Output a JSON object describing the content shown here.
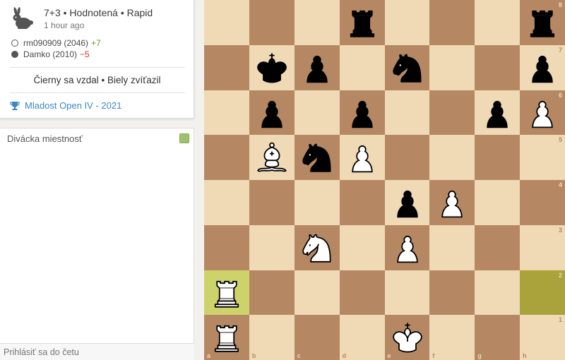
{
  "game": {
    "type": "7+3 • Hodnotená • Rapid",
    "time_ago": "1 hour ago",
    "speed_icon": "rabbit-icon"
  },
  "players": {
    "white": {
      "name": "rm090909 (2046)",
      "diff": "+7"
    },
    "black": {
      "name": "Damko (2010)",
      "diff": "−5"
    }
  },
  "result": "Čierny sa vzdal • Biely zvíťazil",
  "tournament": {
    "icon": "trophy-icon",
    "name": "Mladost Open IV - 2021"
  },
  "chat": {
    "title": "Divácka miestnosť",
    "placeholder": "Prihlásiť sa do četu"
  },
  "board": {
    "files": [
      "a",
      "b",
      "c",
      "d",
      "e",
      "f",
      "g",
      "h"
    ],
    "ranks": [
      "8",
      "7",
      "6",
      "5",
      "4",
      "3",
      "2",
      "1"
    ],
    "colors": {
      "light": "#f0d9b5",
      "dark": "#b58863",
      "highlight_light": "#cdd26a",
      "highlight_dark": "#aaa23a"
    },
    "highlights": [
      "a2",
      "h2"
    ],
    "pieces": [
      {
        "square": "d8",
        "piece": "black-rook"
      },
      {
        "square": "h8",
        "piece": "black-rook"
      },
      {
        "square": "b7",
        "piece": "black-king"
      },
      {
        "square": "c7",
        "piece": "black-pawn"
      },
      {
        "square": "e7",
        "piece": "black-knight"
      },
      {
        "square": "h7",
        "piece": "black-pawn"
      },
      {
        "square": "b6",
        "piece": "black-pawn"
      },
      {
        "square": "d6",
        "piece": "black-pawn"
      },
      {
        "square": "g6",
        "piece": "black-pawn"
      },
      {
        "square": "h6",
        "piece": "white-pawn"
      },
      {
        "square": "b5",
        "piece": "white-bishop"
      },
      {
        "square": "c5",
        "piece": "black-knight"
      },
      {
        "square": "d5",
        "piece": "white-pawn"
      },
      {
        "square": "e4",
        "piece": "black-pawn"
      },
      {
        "square": "f4",
        "piece": "white-pawn"
      },
      {
        "square": "c3",
        "piece": "white-knight"
      },
      {
        "square": "e3",
        "piece": "white-pawn"
      },
      {
        "square": "a2",
        "piece": "white-rook"
      },
      {
        "square": "a1",
        "piece": "white-rook"
      },
      {
        "square": "e1",
        "piece": "white-king"
      }
    ]
  }
}
